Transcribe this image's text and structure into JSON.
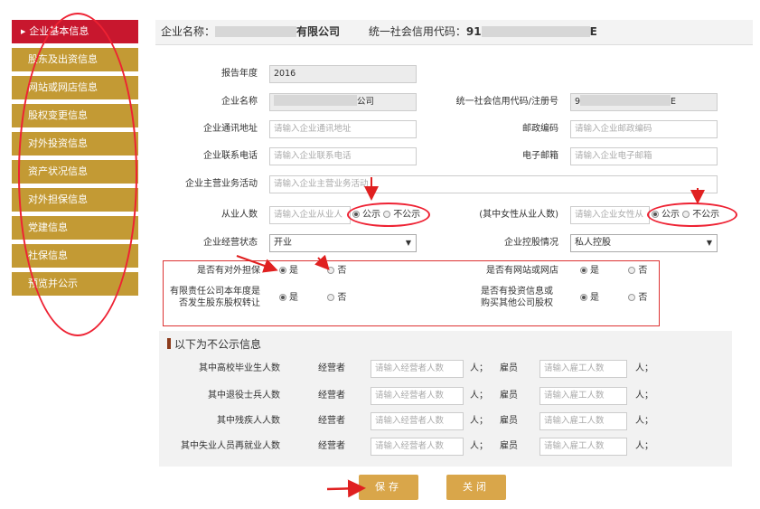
{
  "sidebar": {
    "items": [
      {
        "label": "企业基本信息"
      },
      {
        "label": "股东及出资信息"
      },
      {
        "label": "网站或网店信息"
      },
      {
        "label": "股权变更信息"
      },
      {
        "label": "对外投资信息"
      },
      {
        "label": "资产状况信息"
      },
      {
        "label": "对外担保信息"
      },
      {
        "label": "党建信息"
      },
      {
        "label": "社保信息"
      },
      {
        "label": "预览并公示"
      }
    ]
  },
  "header": {
    "name_label": "企业名称：",
    "name_suffix": "有限公司",
    "code_label": "统一社会信用代码：",
    "code_prefix": "91",
    "code_suffix": "E"
  },
  "form": {
    "year_label": "报告年度",
    "year_value": "2016",
    "company_label": "企业名称",
    "company_suffix": "公司",
    "code_label": "统一社会信用代码/注册号",
    "code_value_prefix": "9",
    "code_value_suffix": "E",
    "address_label": "企业通讯地址",
    "address_placeholder": "请输入企业通讯地址",
    "postcode_label": "邮政编码",
    "postcode_placeholder": "请输入企业邮政编码",
    "phone_label": "企业联系电话",
    "phone_placeholder": "请输入企业联系电话",
    "email_label": "电子邮箱",
    "email_placeholder": "请输入企业电子邮箱",
    "business_label": "企业主营业务活动",
    "business_placeholder": "请输入企业主营业务活动",
    "employees_label": "从业人数",
    "employees_placeholder": "请输入企业从业人",
    "female_label": "(其中女性从业人数)",
    "female_placeholder": "请输入企业女性从",
    "publish": "公示",
    "not_publish": "不公示",
    "status_label": "企业经营状态",
    "status_value": "开业",
    "holding_label": "企业控股情况",
    "holding_value": "私人控股",
    "guarantee_label": "是否有对外担保",
    "website_label": "是否有网站或网店",
    "transfer_label_1": "有限责任公司本年度是",
    "transfer_label_2": "否发生股东股权转让",
    "invest_label_1": "是否有投资信息或",
    "invest_label_2": "购买其他公司股权",
    "yes": "是",
    "no": "否"
  },
  "hidden": {
    "title": "以下为不公示信息",
    "rows": [
      {
        "label": "其中高校毕业生人数"
      },
      {
        "label": "其中退役士兵人数"
      },
      {
        "label": "其中残疾人人数"
      },
      {
        "label": "其中失业人员再就业人数"
      }
    ],
    "operator_label": "经营者",
    "operator_placeholder": "请输入经营者人数",
    "employee_label": "雇员",
    "employee_placeholder": "请输入雇工人数",
    "unit_sep": "人；",
    "unit_end": "人；"
  },
  "buttons": {
    "save": "保存",
    "close": "关闭"
  },
  "colors": {
    "accent": "#c39a34",
    "active": "#c8172e",
    "annotation": "#e02020"
  }
}
